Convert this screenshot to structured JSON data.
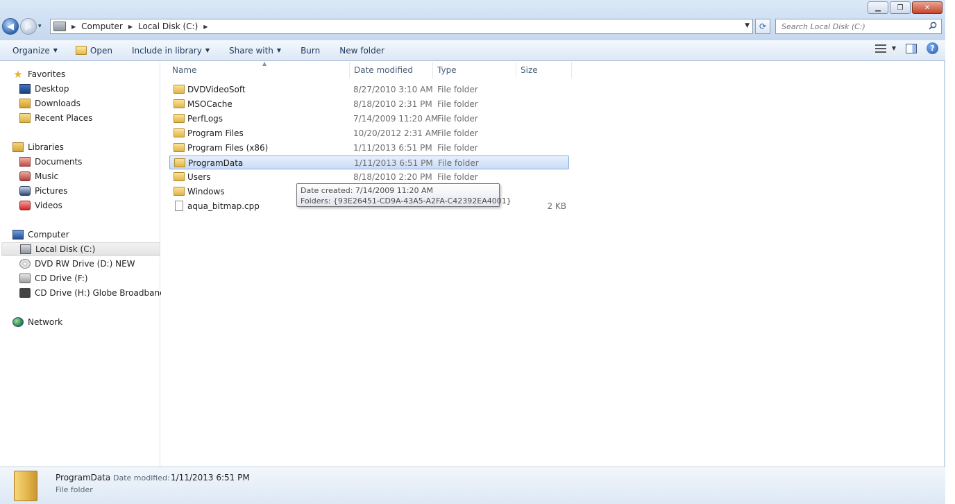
{
  "window": {
    "controls": {
      "minimize": "▁",
      "maximize": "❐",
      "close": "✕"
    }
  },
  "nav": {
    "back": "◀",
    "forward": "▶",
    "recent_caret": "▾"
  },
  "address": {
    "crumbs": [
      "Computer",
      "Local Disk (C:)"
    ],
    "refresh": "⟳"
  },
  "search": {
    "placeholder": "Search Local Disk (C:)"
  },
  "toolbar": {
    "organize": "Organize",
    "open": "Open",
    "include_in_library": "Include in library",
    "share_with": "Share with",
    "burn": "Burn",
    "new_folder": "New folder",
    "help": "?"
  },
  "sidebar": {
    "favorites": {
      "label": "Favorites",
      "items": [
        "Desktop",
        "Downloads",
        "Recent Places"
      ]
    },
    "libraries": {
      "label": "Libraries",
      "items": [
        "Documents",
        "Music",
        "Pictures",
        "Videos"
      ]
    },
    "computer": {
      "label": "Computer",
      "items": [
        "Local Disk (C:)",
        "DVD RW Drive (D:) NEW",
        "CD Drive (F:)",
        "CD Drive (H:) Globe Broadband"
      ],
      "selected": "Local Disk (C:)"
    },
    "network": {
      "label": "Network"
    }
  },
  "columns": {
    "name": "Name",
    "date_modified": "Date modified",
    "type": "Type",
    "size": "Size"
  },
  "files": [
    {
      "name": "DVDVideoSoft",
      "date": "8/27/2010 3:10 AM",
      "type": "File folder",
      "size": ""
    },
    {
      "name": "MSOCache",
      "date": "8/18/2010 2:31 PM",
      "type": "File folder",
      "size": ""
    },
    {
      "name": "PerfLogs",
      "date": "7/14/2009 11:20 AM",
      "type": "File folder",
      "size": ""
    },
    {
      "name": "Program Files",
      "date": "10/20/2012 2:31 AM",
      "type": "File folder",
      "size": ""
    },
    {
      "name": "Program Files (x86)",
      "date": "1/11/2013 6:51 PM",
      "type": "File folder",
      "size": ""
    },
    {
      "name": "ProgramData",
      "date": "1/11/2013 6:51 PM",
      "type": "File folder",
      "size": ""
    },
    {
      "name": "Users",
      "date": "8/18/2010 2:20 PM",
      "type": "File folder",
      "size": ""
    },
    {
      "name": "Windows",
      "date": "",
      "type": "",
      "size": ""
    },
    {
      "name": "aqua_bitmap.cpp",
      "date": "",
      "type": "",
      "size": "2 KB"
    }
  ],
  "tooltip": {
    "line1": "Date created: 7/14/2009 11:20 AM",
    "line2": "Folders: {93E26451-CD9A-43A5-A2FA-C42392EA4001}"
  },
  "details": {
    "name": "ProgramData",
    "modified_label": "Date modified:",
    "modified_value": "1/11/2013 6:51 PM",
    "type": "File folder"
  }
}
